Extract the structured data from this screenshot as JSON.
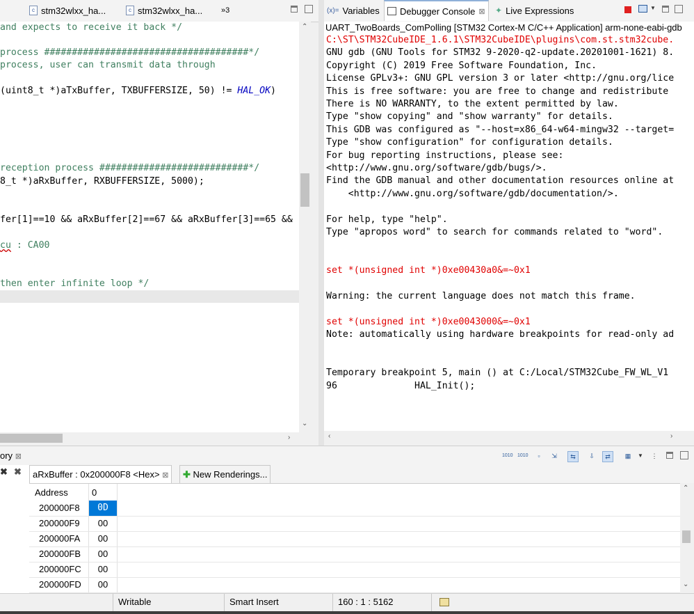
{
  "editor": {
    "tabs": [
      {
        "label": "stm32wlxx_ha..."
      },
      {
        "label": "stm32wlxx_ha..."
      }
    ],
    "overflow_label": "»3",
    "lines": [
      {
        "t": "and expects to receive it back */"
      },
      {
        "t": "process #####################################*/"
      },
      {
        "t": "process, user can transmit data through"
      },
      {
        "t": "(uint8_t *)aTxBuffer, TXBUFFERSIZE, 50) != ",
        "kw": "HAL_OK",
        "tail": ")"
      },
      {
        "t": "reception process ###########################*/"
      },
      {
        "t": "8_t *)aRxBuffer, RXBUFFERSIZE, 5000);"
      },
      {
        "t": "fer[1]==10 && aRxBuffer[2]==67 && aRxBuffer[3]==65 &&"
      },
      {
        "u": "cu",
        "t": " : CA00"
      },
      {
        "t": "then enter infinite loop */"
      }
    ]
  },
  "debug_panel": {
    "tabs": [
      {
        "label": "Variables"
      },
      {
        "label": "Debugger Console"
      },
      {
        "label": "Live Expressions"
      }
    ],
    "session_title": "UART_TwoBoards_ComPolling [STM32 Cortex-M C/C++ Application] arm-none-eabi-gdb",
    "console_lines": [
      {
        "t": "C:\\ST\\STM32CubeIDE_1.6.1\\STM32CubeIDE\\plugins\\com.st.stm32cube.",
        "red": true
      },
      {
        "t": "GNU gdb (GNU Tools for STM32 9-2020-q2-update.20201001-1621) 8."
      },
      {
        "t": "Copyright (C) 2019 Free Software Foundation, Inc."
      },
      {
        "t": "License GPLv3+: GNU GPL version 3 or later <http://gnu.org/lice"
      },
      {
        "t": "This is free software: you are free to change and redistribute"
      },
      {
        "t": "There is NO WARRANTY, to the extent permitted by law."
      },
      {
        "t": "Type \"show copying\" and \"show warranty\" for details."
      },
      {
        "t": "This GDB was configured as \"--host=x86_64-w64-mingw32 --target="
      },
      {
        "t": "Type \"show configuration\" for configuration details."
      },
      {
        "t": "For bug reporting instructions, please see:"
      },
      {
        "t": "<http://www.gnu.org/software/gdb/bugs/>."
      },
      {
        "t": "Find the GDB manual and other documentation resources online at"
      },
      {
        "t": "    <http://www.gnu.org/software/gdb/documentation/>."
      },
      {
        "t": ""
      },
      {
        "t": "For help, type \"help\"."
      },
      {
        "t": "Type \"apropos word\" to search for commands related to \"word\"."
      },
      {
        "t": ""
      },
      {
        "t": ""
      },
      {
        "t": "set *(unsigned int *)0xe00430a0&=~0x1",
        "red": true
      },
      {
        "t": ""
      },
      {
        "t": "Warning: the current language does not match this frame."
      },
      {
        "t": ""
      },
      {
        "t": "set *(unsigned int *)0xe0043000&=~0x1",
        "red": true
      },
      {
        "t": "Note: automatically using hardware breakpoints for read-only ad"
      },
      {
        "t": ""
      },
      {
        "t": ""
      },
      {
        "t": "Temporary breakpoint 5, main () at C:/Local/STM32Cube_FW_WL_V1"
      },
      {
        "t": "96              HAL_Init();"
      }
    ]
  },
  "memory": {
    "view_tab": "ory",
    "rendering_tab": "aRxBuffer : 0x200000F8 <Hex>",
    "new_renderings": "New Renderings...",
    "col_address": "Address",
    "col_0": "0",
    "rows": [
      {
        "addr": "200000F8",
        "val": "0D",
        "selected": true
      },
      {
        "addr": "200000F9",
        "val": "00"
      },
      {
        "addr": "200000FA",
        "val": "00"
      },
      {
        "addr": "200000FB",
        "val": "00"
      },
      {
        "addr": "200000FC",
        "val": "00"
      },
      {
        "addr": "200000FD",
        "val": "00"
      }
    ]
  },
  "status": {
    "writable": "Writable",
    "insert_mode": "Smart Insert",
    "position": "160 : 1 : 5162"
  },
  "colors": {
    "comment": "#3f7f5f",
    "keyword": "#0000c0",
    "console_red": "#e00000",
    "selection": "#0078d7"
  }
}
